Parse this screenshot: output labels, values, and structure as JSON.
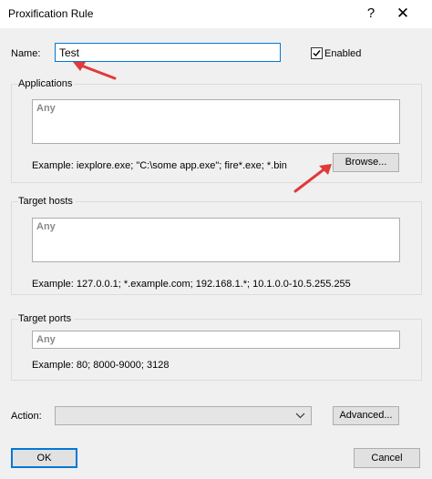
{
  "window": {
    "title": "Proxification Rule",
    "help_glyph": "?",
    "close_glyph": "✕"
  },
  "name_row": {
    "label": "Name:",
    "value": "Test",
    "enabled_label": "Enabled",
    "enabled_checked": true
  },
  "applications": {
    "title": "Applications",
    "placeholder": "Any",
    "example": "Example: iexplore.exe; \"C:\\some app.exe\"; fire*.exe; *.bin",
    "browse_label": "Browse..."
  },
  "target_hosts": {
    "title": "Target hosts",
    "placeholder": "Any",
    "example": "Example: 127.0.0.1; *.example.com; 192.168.1.*; 10.1.0.0-10.5.255.255"
  },
  "target_ports": {
    "title": "Target ports",
    "placeholder": "Any",
    "example": "Example: 80; 8000-9000; 3128"
  },
  "action_row": {
    "label": "Action:",
    "selected": "",
    "advanced_label": "Advanced..."
  },
  "footer": {
    "ok_label": "OK",
    "cancel_label": "Cancel"
  },
  "colors": {
    "accent": "#0078d7",
    "annotation_arrow": "#e03a3a"
  },
  "icons": {
    "help": "question-mark-icon",
    "close": "close-icon",
    "checkbox": "checkmark-icon",
    "dropdown": "chevron-down-icon"
  }
}
